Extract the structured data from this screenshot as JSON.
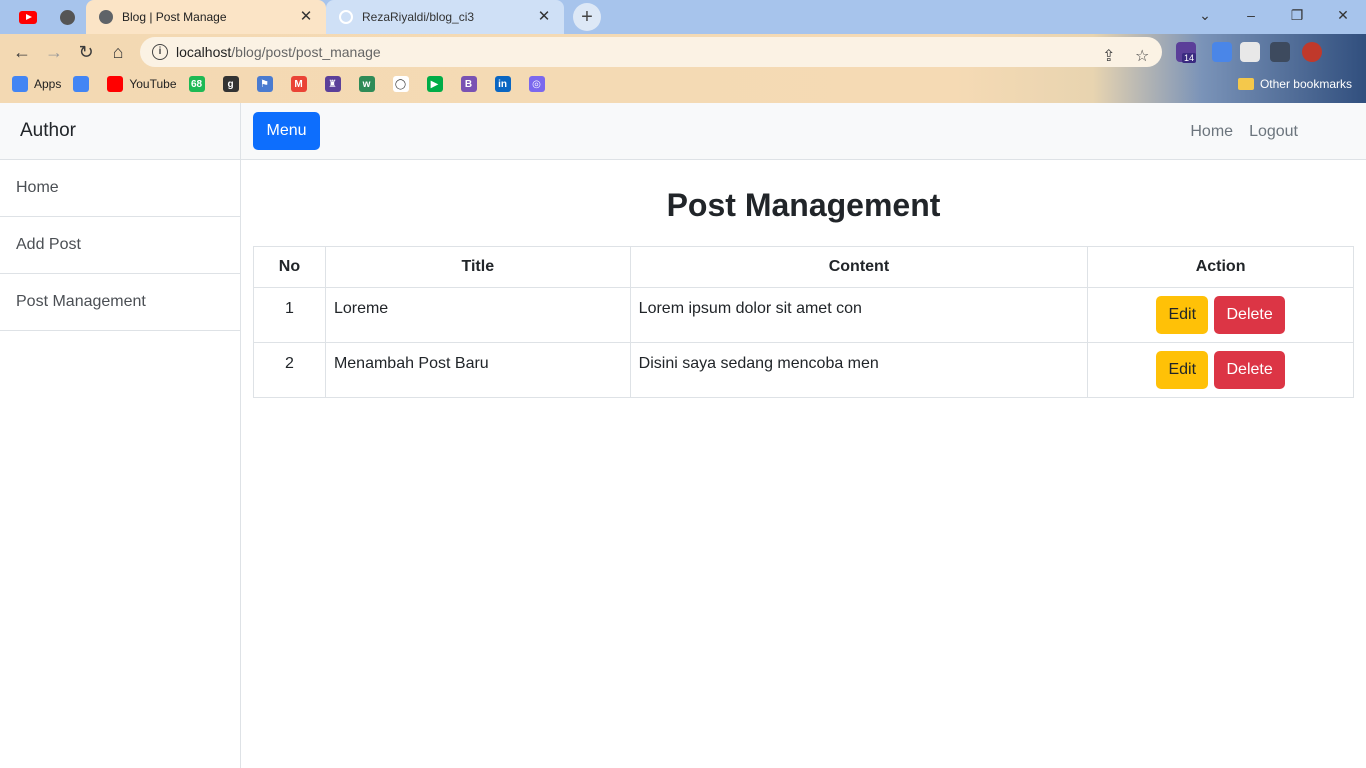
{
  "browser": {
    "tabs": [
      {
        "title": "Blog | Post Manage",
        "active": true
      },
      {
        "title": "RezaRiyaldi/blog_ci3",
        "active": false
      }
    ],
    "new_tab_icon": "+",
    "window_controls": {
      "dropdown": "⌄",
      "minimize": "–",
      "restore": "❐",
      "close": "✕"
    },
    "url_host": "localhost",
    "url_path": "/blog/post/post_manage",
    "extension_badge": "14",
    "bookmarks": [
      {
        "label": "Apps",
        "icon": "apps-grid-icon",
        "color": "#4285f4"
      },
      {
        "label": "",
        "icon": "google-translate-icon",
        "color": "#4285f4"
      },
      {
        "label": "YouTube",
        "icon": "youtube-icon",
        "color": "#ff0000"
      },
      {
        "label": "",
        "icon": "badge-68-icon",
        "color": "#1db954",
        "glyph": "68"
      },
      {
        "label": "",
        "icon": "g-icon",
        "color": "#333333",
        "glyph": "g"
      },
      {
        "label": "",
        "icon": "flag-icon",
        "color": "#4a7bd0",
        "glyph": "⚑"
      },
      {
        "label": "",
        "icon": "gmail-icon",
        "color": "#ea4335",
        "glyph": "M"
      },
      {
        "label": "",
        "icon": "tower-icon",
        "color": "#5b3f99",
        "glyph": "♜"
      },
      {
        "label": "",
        "icon": "w3-icon",
        "color": "#2e8b57",
        "glyph": "w"
      },
      {
        "label": "",
        "icon": "github-icon",
        "color": "#ffffff",
        "glyph": "◯"
      },
      {
        "label": "",
        "icon": "meet-icon",
        "color": "#00ac47",
        "glyph": "▶"
      },
      {
        "label": "",
        "icon": "bootstrap-icon",
        "color": "#7952b3",
        "glyph": "B"
      },
      {
        "label": "",
        "icon": "linkedin-icon",
        "color": "#0a66c2",
        "glyph": "in"
      },
      {
        "label": "",
        "icon": "search-app-icon",
        "color": "#7b68ee",
        "glyph": "◎"
      }
    ],
    "other_bookmarks": "Other bookmarks"
  },
  "sidebar": {
    "heading": "Author",
    "items": [
      {
        "label": "Home"
      },
      {
        "label": "Add Post"
      },
      {
        "label": "Post Management"
      }
    ]
  },
  "topnav": {
    "menu_label": "Menu",
    "links": [
      {
        "label": "Home"
      },
      {
        "label": "Logout"
      }
    ]
  },
  "main": {
    "title": "Post Management",
    "table": {
      "headers": [
        "No",
        "Title",
        "Content",
        "Action"
      ],
      "rows": [
        {
          "no": "1",
          "title": "Loreme",
          "content": "Lorem ipsum dolor sit amet con"
        },
        {
          "no": "2",
          "title": "Menambah Post Baru",
          "content": "Disini saya sedang mencoba men"
        }
      ],
      "edit_label": "Edit",
      "delete_label": "Delete"
    }
  },
  "colors": {
    "primary": "#0d6efd",
    "warning": "#ffc107",
    "danger": "#dc3545"
  }
}
